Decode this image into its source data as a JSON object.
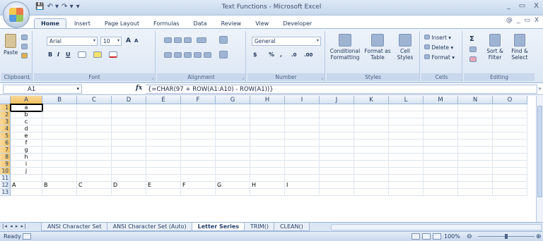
{
  "window": {
    "title": "Text Functions - Microsoft Excel",
    "controls": [
      "_",
      "▭",
      "X"
    ],
    "ribbon_controls": [
      "@",
      "_",
      "▭",
      "X"
    ]
  },
  "quick_access": [
    "💾",
    "↶ ▾",
    "↷ ▾",
    "▾"
  ],
  "tabs": [
    "Home",
    "Insert",
    "Page Layout",
    "Formulas",
    "Data",
    "Review",
    "View",
    "Developer"
  ],
  "ribbon": {
    "clipboard": {
      "paste": "Paste",
      "label": "Clipboard"
    },
    "font": {
      "name": "Arial",
      "size": "10",
      "grow": "A",
      "shrink": "A",
      "bold": "B",
      "italic": "I",
      "underline": "U",
      "label": "Font"
    },
    "alignment": {
      "label": "Alignment"
    },
    "number": {
      "format": "General",
      "currency": "$",
      "percent": "%",
      "comma": ",",
      "inc_dec": ".0",
      "dec_dec": ".00",
      "label": "Number"
    },
    "styles": {
      "conditional": "Conditional Formatting",
      "format_table": "Format as Table",
      "cell_styles": "Cell Styles",
      "label": "Styles"
    },
    "cells": {
      "insert": "Insert",
      "delete": "Delete",
      "format": "Format",
      "label": "Cells"
    },
    "editing": {
      "sigma": "Σ",
      "sort": "Sort & Filter",
      "find": "Find & Select",
      "label": "Editing"
    }
  },
  "formula_bar": {
    "name_box": "A1",
    "fx": "fx",
    "formula": "{=CHAR(97 + ROW(A1:A10) - ROW(A1))}"
  },
  "columns": [
    "A",
    "B",
    "C",
    "D",
    "E",
    "F",
    "G",
    "H",
    "I",
    "J",
    "K",
    "L",
    "M",
    "N",
    "O"
  ],
  "rows": [
    {
      "n": "1",
      "A": "a"
    },
    {
      "n": "2",
      "A": "b"
    },
    {
      "n": "3",
      "A": "c"
    },
    {
      "n": "4",
      "A": "d"
    },
    {
      "n": "5",
      "A": "e"
    },
    {
      "n": "6",
      "A": "f"
    },
    {
      "n": "7",
      "A": "g"
    },
    {
      "n": "8",
      "A": "h"
    },
    {
      "n": "9",
      "A": "i"
    },
    {
      "n": "10",
      "A": "j"
    },
    {
      "n": "11"
    },
    {
      "n": "12",
      "row12": [
        "A",
        "B",
        "C",
        "D",
        "E",
        "F",
        "G",
        "H",
        "I"
      ]
    },
    {
      "n": "13"
    }
  ],
  "sheet_tabs": [
    "ANSI Character Set",
    "ANSI Character Set (Auto)",
    "Letter Series",
    "TRIM()",
    "CLEAN()"
  ],
  "active_sheet": "Letter Series",
  "status": {
    "ready": "Ready",
    "zoom": "100%",
    "minus": "⊖",
    "plus": "⊕"
  }
}
